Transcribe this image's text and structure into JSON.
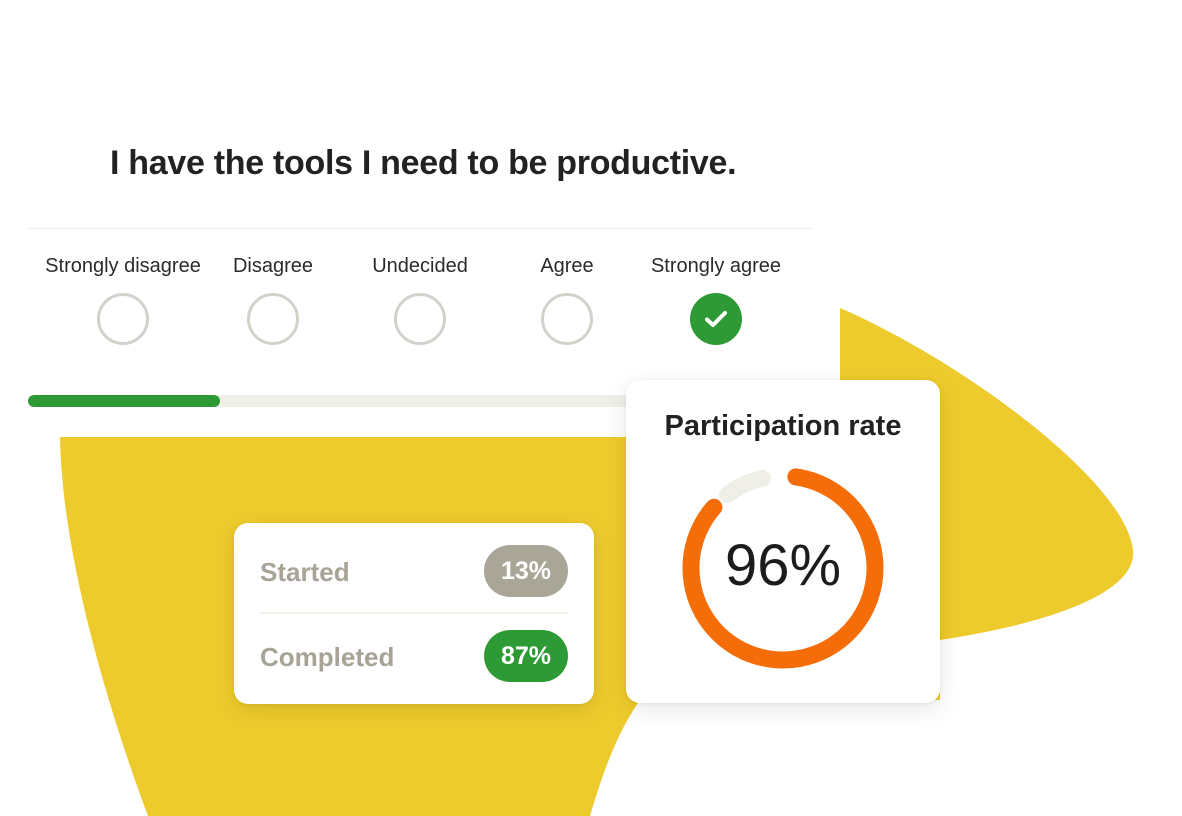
{
  "question": "I have the tools I need to be productive.",
  "options": [
    {
      "label": "Strongly disagree",
      "selected": false
    },
    {
      "label": "Disagree",
      "selected": false
    },
    {
      "label": "Undecided",
      "selected": false
    },
    {
      "label": "Agree",
      "selected": false
    },
    {
      "label": "Strongly agree",
      "selected": true
    }
  ],
  "progress": {
    "fraction": 0.3
  },
  "status_card": {
    "started_label": "Started",
    "started_value": "13%",
    "completed_label": "Completed",
    "completed_value": "87%"
  },
  "participation": {
    "title": "Participation rate",
    "value": "96%",
    "fraction": 0.96
  },
  "colors": {
    "accent_green": "#2e9a35",
    "brand_yellow": "#eecb2c",
    "donut_orange": "#f56d09",
    "muted_gray": "#a9a698"
  },
  "icons": [
    "check-icon"
  ]
}
